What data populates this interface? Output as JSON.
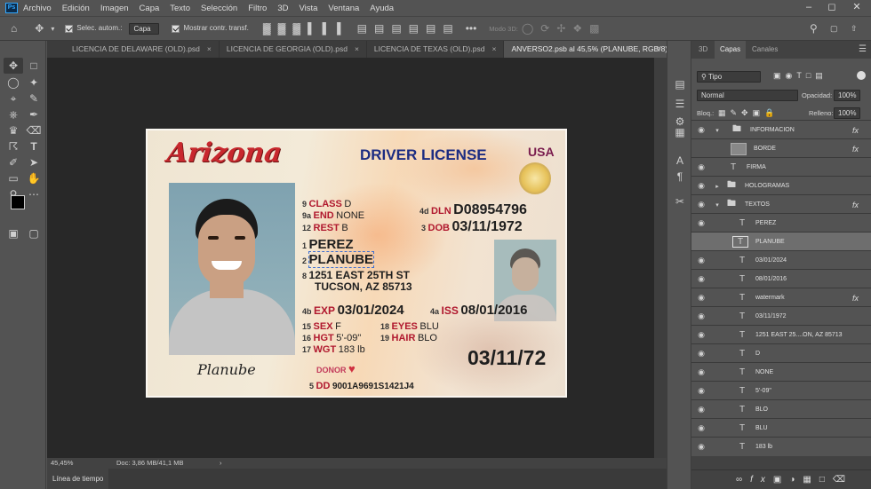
{
  "menu": [
    "Archivo",
    "Edición",
    "Imagen",
    "Capa",
    "Texto",
    "Selección",
    "Filtro",
    "3D",
    "Vista",
    "Ventana",
    "Ayuda"
  ],
  "options": {
    "auto_select": "Selec. autom.:",
    "layer_select": "Capa",
    "show_transform": "Mostrar contr. transf.",
    "mode3d": "Modo 3D:"
  },
  "tabs": [
    {
      "label": "LICENCIA DE DELAWARE (OLD).psd"
    },
    {
      "label": "LICENCIA DE GEORGIA (OLD).psd"
    },
    {
      "label": "LICENCIA DE TEXAS (OLD).psd"
    },
    {
      "label": "ANVERSO2.psb al 45,5% (PLANUBE, RGB/8)"
    }
  ],
  "license": {
    "state": "Arizona",
    "title": "DRIVER LICENSE",
    "country": "USA",
    "dln_num": "4d",
    "dln_label": "DLN",
    "dln": "D08954796",
    "dob_num": "3",
    "dob_label": "DOB",
    "dob": "03/11/1972",
    "class_num": "9",
    "class_label": "CLASS",
    "class": "D",
    "end_num": "9a",
    "end_label": "END",
    "end": "NONE",
    "rest_num": "12",
    "rest_label": "REST",
    "rest": "B",
    "ln_num": "1",
    "last_name": "PEREZ",
    "fn_num": "2",
    "first_name": "PLANUBE",
    "addr_num": "8",
    "address1": "1251 EAST 25TH ST",
    "address2": "TUCSON, AZ 85713",
    "exp_num": "4b",
    "exp_label": "EXP",
    "exp": "03/01/2024",
    "iss_num": "4a",
    "iss_label": "ISS",
    "iss": "08/01/2016",
    "sex_num": "15",
    "sex_label": "SEX",
    "sex": "F",
    "eyes_num": "18",
    "eyes_label": "EYES",
    "eyes": "BLU",
    "hgt_num": "16",
    "hgt_label": "HGT",
    "hgt": "5'-09\"",
    "hair_num": "19",
    "hair_label": "HAIR",
    "hair": "BLO",
    "wgt_num": "17",
    "wgt_label": "WGT",
    "wgt": "183 lb",
    "donor": "DONOR",
    "big_dob": "03/11/72",
    "dd_num": "5",
    "dd_label": "DD",
    "dd": "9001A9691S1421J4",
    "signature": "Planube"
  },
  "status": {
    "zoom": "45,45%",
    "doc": "Doc: 3,86 MB/41,1 MB"
  },
  "timeline": "Línea de tiempo",
  "panel": {
    "tabs": [
      "3D",
      "Capas",
      "Canales"
    ],
    "filter": "Tipo",
    "blend": "Normal",
    "opacity_label": "Opacidad:",
    "opacity": "100%",
    "lock_label": "Bloq.:",
    "fill_label": "Relleno:",
    "fill": "100%"
  },
  "layers": [
    {
      "name": "INFORMACION",
      "kind": "group",
      "fx": "fx"
    },
    {
      "name": "BORDE",
      "kind": "image",
      "fx": "fx"
    },
    {
      "name": "FIRMA",
      "kind": "text",
      "fx": ""
    },
    {
      "name": "HOLOGRAMAS",
      "kind": "group",
      "fx": ""
    },
    {
      "name": "TEXTOS",
      "kind": "group",
      "fx": "fx"
    },
    {
      "name": "PEREZ",
      "kind": "text",
      "fx": ""
    },
    {
      "name": "PLANUBE",
      "kind": "text",
      "fx": ""
    },
    {
      "name": "03/01/2024",
      "kind": "text",
      "fx": ""
    },
    {
      "name": "08/01/2016",
      "kind": "text",
      "fx": ""
    },
    {
      "name": "watermark",
      "kind": "text",
      "fx": "fx"
    },
    {
      "name": "03/11/1972",
      "kind": "text",
      "fx": ""
    },
    {
      "name": "1251 EAST 25....ON, AZ 85713",
      "kind": "text",
      "fx": ""
    },
    {
      "name": "D",
      "kind": "text",
      "fx": ""
    },
    {
      "name": "NONE",
      "kind": "text",
      "fx": ""
    },
    {
      "name": "5'-09\"",
      "kind": "text",
      "fx": ""
    },
    {
      "name": "BLO",
      "kind": "text",
      "fx": ""
    },
    {
      "name": "BLU",
      "kind": "text",
      "fx": ""
    },
    {
      "name": "183 lb",
      "kind": "text",
      "fx": ""
    }
  ]
}
